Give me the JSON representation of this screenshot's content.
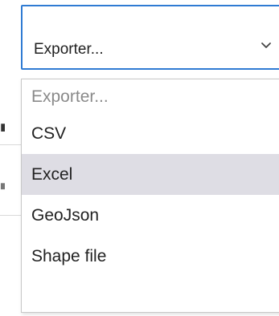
{
  "select": {
    "selected_label": "Exporter...",
    "icon": "chevron-down-icon"
  },
  "options": [
    {
      "label": "Exporter...",
      "placeholder": true,
      "highlighted": false
    },
    {
      "label": "CSV",
      "placeholder": false,
      "highlighted": false
    },
    {
      "label": "Excel",
      "placeholder": false,
      "highlighted": true
    },
    {
      "label": "GeoJson",
      "placeholder": false,
      "highlighted": false
    },
    {
      "label": "Shape file",
      "placeholder": false,
      "highlighted": false
    }
  ],
  "colors": {
    "focus_border": "#2f7bd3",
    "highlight_bg": "#dedde4",
    "placeholder_text": "#8a8a8a"
  }
}
